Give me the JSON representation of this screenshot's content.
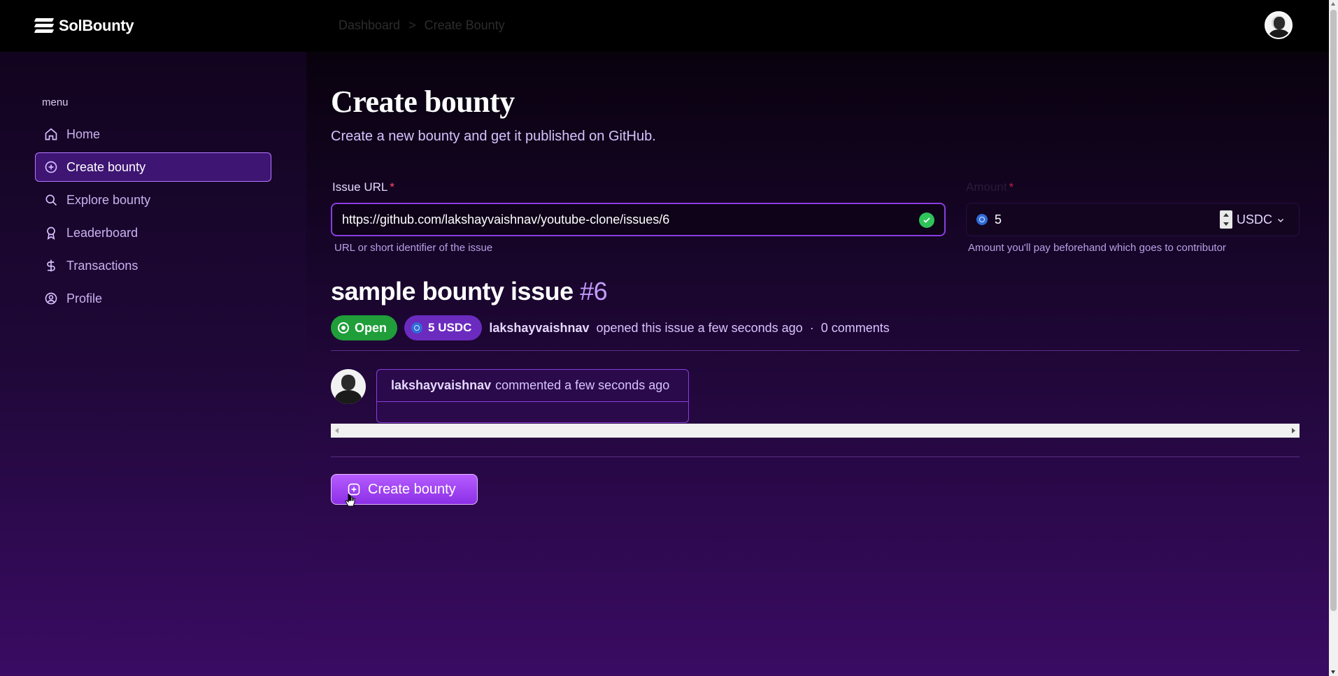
{
  "app": {
    "name": "SolBounty"
  },
  "breadcrumb": {
    "items": [
      "Dashboard",
      "Create Bounty"
    ],
    "separator": ">"
  },
  "sidebar": {
    "menu_label": "menu",
    "items": [
      {
        "label": "Home",
        "icon": "home-icon",
        "active": false
      },
      {
        "label": "Create bounty",
        "icon": "plus-circle-icon",
        "active": true
      },
      {
        "label": "Explore bounty",
        "icon": "search-icon",
        "active": false
      },
      {
        "label": "Leaderboard",
        "icon": "award-icon",
        "active": false
      },
      {
        "label": "Transactions",
        "icon": "dollar-icon",
        "active": false
      },
      {
        "label": "Profile",
        "icon": "user-circle-icon",
        "active": false
      }
    ]
  },
  "main": {
    "title": "Create bounty",
    "subtitle": "Create a new bounty and get it published on GitHub.",
    "issue_url": {
      "label": "Issue URL",
      "required_mark": "*",
      "value": "https://github.com/lakshayvaishnav/youtube-clone/issues/6",
      "helper": "URL or short identifier of the issue"
    },
    "amount": {
      "label": "Amount",
      "required_mark": "*",
      "value": "5",
      "currency": "USDC",
      "helper": "Amount you'll pay beforehand which goes to contributor"
    },
    "issue": {
      "title": "sample bounty issue",
      "number": "#6",
      "status": "Open",
      "bounty_badge": "5 USDC",
      "author": "lakshayvaishnav",
      "opened_text": "opened this issue a few seconds ago",
      "dot": "·",
      "comments_text": "0 comments"
    },
    "comment": {
      "author": "lakshayvaishnav",
      "text": "commented a few seconds ago"
    },
    "create_button": "Create bounty"
  },
  "colors": {
    "accent": "#8a3de0",
    "open_badge": "#1f9e3a",
    "usdc_badge": "#6b2bbf",
    "button": "#a64af2"
  }
}
